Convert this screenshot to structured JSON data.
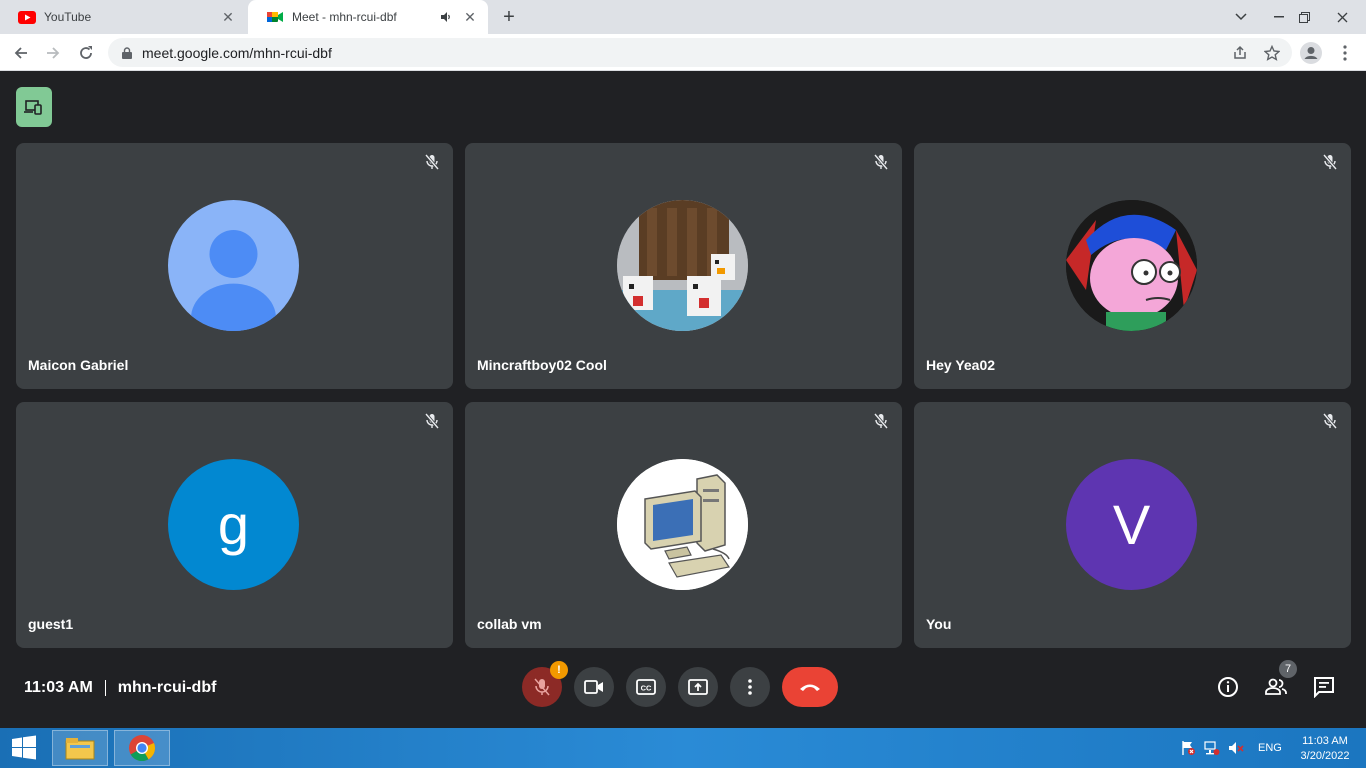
{
  "browser": {
    "tabs": [
      {
        "title": "YouTube",
        "favicon": "youtube-icon",
        "active": false
      },
      {
        "title": "Meet - mhn-rcui-dbf",
        "favicon": "meet-icon",
        "active": true,
        "audio": true
      }
    ],
    "url": "meet.google.com/mhn-rcui-dbf"
  },
  "meet": {
    "participants": [
      {
        "name": "Maicon Gabriel",
        "avatar": "default-person-icon",
        "avatar_color": "#8ab4f8"
      },
      {
        "name": "Mincraftboy02 Cool",
        "avatar": "minecraft-chickens-image"
      },
      {
        "name": "Hey Yea02",
        "avatar": "cartoon-character-image"
      },
      {
        "name": "guest1",
        "avatar_letter": "g",
        "avatar_color": "#0288d1"
      },
      {
        "name": "collab vm",
        "avatar": "computer-clipart-image"
      },
      {
        "name": "You",
        "avatar_letter": "V",
        "avatar_color": "#5e35b1"
      }
    ],
    "time": "11:03 AM",
    "meeting_code": "mhn-rcui-dbf",
    "mic_warning": "!",
    "participant_count": "7"
  },
  "taskbar": {
    "lang": "ENG",
    "time": "11:03 AM",
    "date": "3/20/2022"
  },
  "colors": {
    "hangup": "#ea4335",
    "mic_off": "#8c2a26",
    "badge": "#81c995"
  }
}
